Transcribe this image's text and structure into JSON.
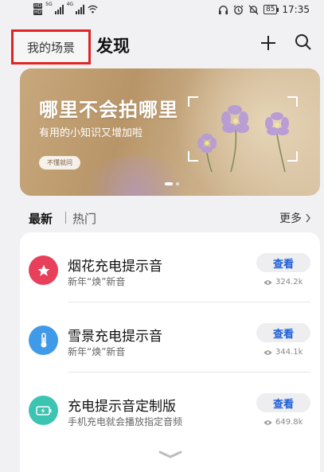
{
  "status_bar": {
    "hd_badges": [
      "HD",
      "HD"
    ],
    "signal1_label": "5G",
    "signal2_label": "4G",
    "battery": "85",
    "time": "17:35"
  },
  "header": {
    "my_scenes_tab": "我的场景",
    "discover_tab": "发现"
  },
  "banner": {
    "title": "哪里不会拍哪里",
    "subtitle": "有用的小知识又增加啦",
    "button_label": "不懂就问"
  },
  "tabs": {
    "latest": "最新",
    "hot": "热门",
    "more": "更多"
  },
  "items": [
    {
      "title": "烟花充电提示音",
      "desc": "新年“焕”新音",
      "button": "查看",
      "views": "324.2k",
      "icon": "star-icon",
      "color": "#e8405a"
    },
    {
      "title": "雪景充电提示音",
      "desc": "新年“焕”新音",
      "button": "查看",
      "views": "344.1k",
      "icon": "thermometer-icon",
      "color": "#3f9ae8"
    },
    {
      "title": "充电提示音定制版",
      "desc": "手机充电就会播放指定音频",
      "button": "查看",
      "views": "649.8k",
      "icon": "battery-charging-icon",
      "color": "#3bc4b1"
    }
  ],
  "colors": {
    "accent_blue": "#1e5fd8",
    "highlight_red": "#e02424"
  }
}
